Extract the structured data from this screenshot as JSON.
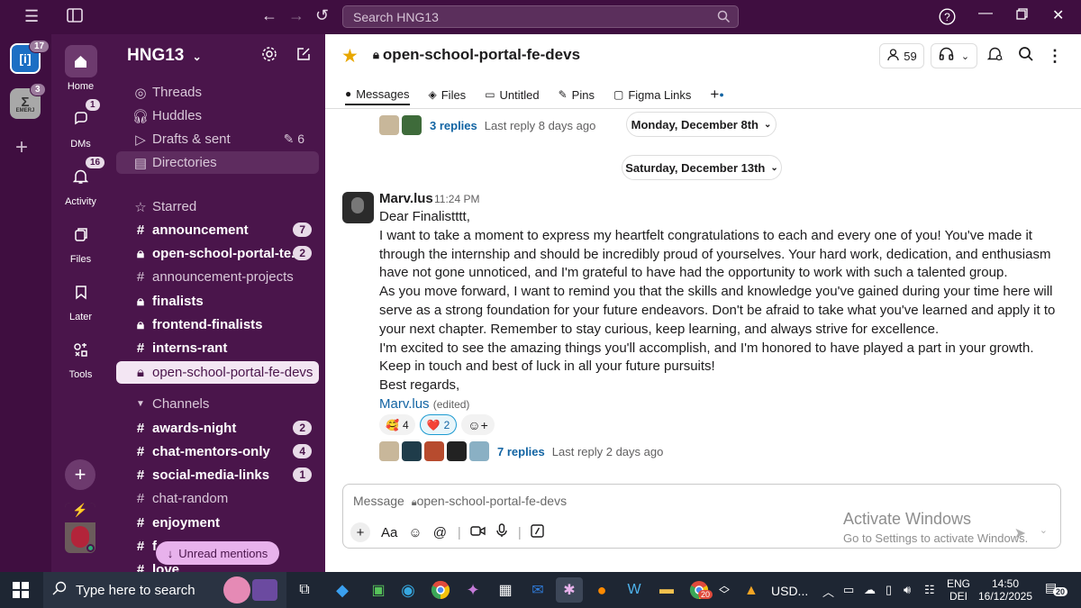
{
  "topbar": {
    "search_placeholder": "Search HNG13"
  },
  "rail": {
    "workspaces": [
      {
        "letters": "[i]",
        "badge": "17"
      },
      {
        "letters": "Σ",
        "sub": "EMERJ",
        "badge": "3"
      }
    ],
    "add": "+"
  },
  "nav": {
    "home": "Home",
    "dms": "DMs",
    "dms_badge": "1",
    "activity": "Activity",
    "activity_badge": "16",
    "files": "Files",
    "later": "Later",
    "tools": "Tools"
  },
  "sidebar": {
    "workspace_name": "HNG13",
    "threads": "Threads",
    "huddles": "Huddles",
    "drafts": "Drafts & sent",
    "drafts_count": "6",
    "directories": "Directories",
    "starred": "Starred",
    "starred_items": [
      {
        "name": "announcement",
        "count": "7"
      },
      {
        "name": "open-school-portal-te...",
        "count": "2"
      },
      {
        "name": "announcement-projects",
        "count": ""
      },
      {
        "name": "finalists",
        "count": ""
      },
      {
        "name": "frontend-finalists",
        "count": ""
      },
      {
        "name": "interns-rant",
        "count": ""
      },
      {
        "name": "open-school-portal-fe-devs",
        "count": ""
      }
    ],
    "channels": "Channels",
    "channel_items": [
      {
        "name": "awards-night",
        "count": "2"
      },
      {
        "name": "chat-mentors-only",
        "count": "4"
      },
      {
        "name": "social-media-links",
        "count": "1"
      },
      {
        "name": "chat-random",
        "count": ""
      },
      {
        "name": "enjoyment",
        "count": ""
      },
      {
        "name": "f",
        "count": ""
      },
      {
        "name": "love",
        "count": ""
      }
    ],
    "unread_mentions": "Unread mentions"
  },
  "channel": {
    "name": "open-school-portal-fe-devs",
    "member_count": "59",
    "tabs": [
      "Messages",
      "Files",
      "Untitled",
      "Pins",
      "Figma Links"
    ]
  },
  "thread_top": {
    "replies": "3 replies",
    "last": "Last reply 8 days ago"
  },
  "dates": {
    "d1": "Monday, December 8th",
    "d2": "Saturday, December 13th"
  },
  "message": {
    "author": "Marv.lus",
    "time": "11:24 PM",
    "lines": [
      "Dear Finalistttt,",
      "I want to take a moment to express my heartfelt congratulations to each and every one of you! You've made it through the internship and should be incredibly proud of yourselves. Your hard work, dedication, and enthusiasm have not gone unnoticed, and I'm grateful to have had the opportunity to work with such a talented group.",
      "As you move forward, I want to remind you that the skills and knowledge you've gained during your time here will serve as a strong foundation for your future endeavors. Don't be afraid to take what you've learned and apply it to your next chapter. Remember to stay curious, keep learning, and always strive for excellence.",
      "I'm excited to see the amazing things you'll accomplish, and I'm honored to have played a part in your growth. Keep in touch and best of luck in all your future pursuits!",
      "Best regards,"
    ],
    "signer": "Marv.lus",
    "edited": "(edited)",
    "reactions": [
      {
        "emoji": "🥰",
        "count": "4"
      },
      {
        "emoji": "❤️",
        "count": "2"
      }
    ],
    "replies": "7 replies",
    "last": "Last reply 2 days ago"
  },
  "composer": {
    "placeholder": "Message",
    "channel": "open-school-portal-fe-devs"
  },
  "watermark": {
    "line1": "Activate Windows",
    "line2": "Go to Settings to activate Windows."
  },
  "taskbar": {
    "search": "Type here to search",
    "stock": "USD...",
    "lang1": "ENG",
    "lang2": "DEI",
    "time": "14:50",
    "date": "16/12/2025",
    "notif": "20",
    "chrome_badge": "20"
  }
}
